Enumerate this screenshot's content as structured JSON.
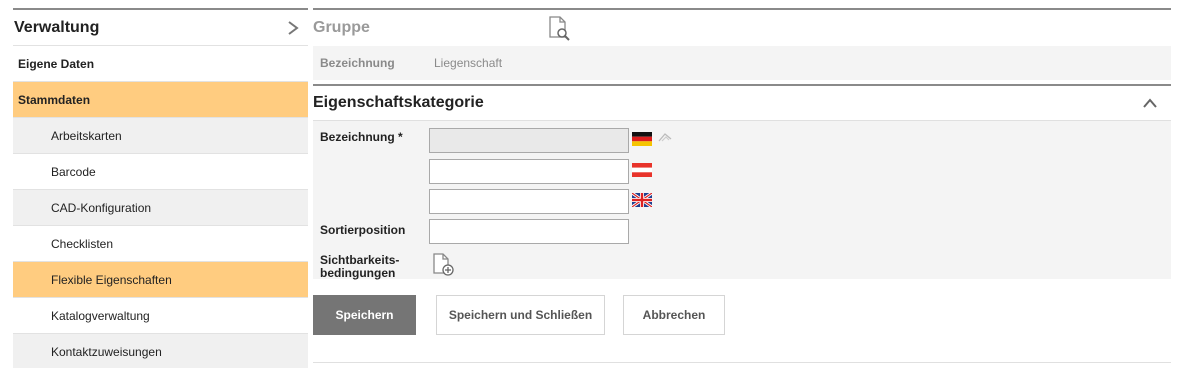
{
  "sidebar": {
    "title": "Verwaltung",
    "chevron_icon": "chevron-right-icon",
    "items": [
      {
        "label": "Eigene Daten",
        "level": 1,
        "active": false
      },
      {
        "label": "Stammdaten",
        "level": 1,
        "active": true
      },
      {
        "label": "Arbeitskarten",
        "level": 2,
        "active": false
      },
      {
        "label": "Barcode",
        "level": 2,
        "active": false
      },
      {
        "label": "CAD-Konfiguration",
        "level": 2,
        "active": false
      },
      {
        "label": "Checklisten",
        "level": 2,
        "active": false
      },
      {
        "label": "Flexible Eigenschaften",
        "level": 2,
        "active": true
      },
      {
        "label": "Katalogverwaltung",
        "level": 2,
        "active": false
      },
      {
        "label": "Kontaktzuweisungen",
        "level": 2,
        "active": false
      }
    ]
  },
  "group": {
    "title": "Gruppe",
    "icon": "document-search-icon",
    "field_label": "Bezeichnung",
    "field_value": "Liegenschaft"
  },
  "category": {
    "title": "Eigenschaftskategorie",
    "collapse_icon": "chevron-up-icon",
    "fields": {
      "bezeichnung_label": "Bezeichnung *",
      "bezeichnung_de": "",
      "bezeichnung_at": "",
      "bezeichnung_en": "",
      "sortierposition_label": "Sortierposition",
      "sortierposition_value": "",
      "sichtbarkeit_label_1": "Sichtbarkeits-",
      "sichtbarkeit_label_2": "bedingungen"
    },
    "flags": [
      "german-flag-icon",
      "austrian-flag-icon",
      "uk-flag-icon"
    ]
  },
  "buttons": {
    "save": "Speichern",
    "save_close": "Speichern und Schließen",
    "cancel": "Abbrechen"
  },
  "colors": {
    "active_bg": "#ffcc80",
    "primary_button": "#757575",
    "header_rule": "#8a8a8a"
  }
}
